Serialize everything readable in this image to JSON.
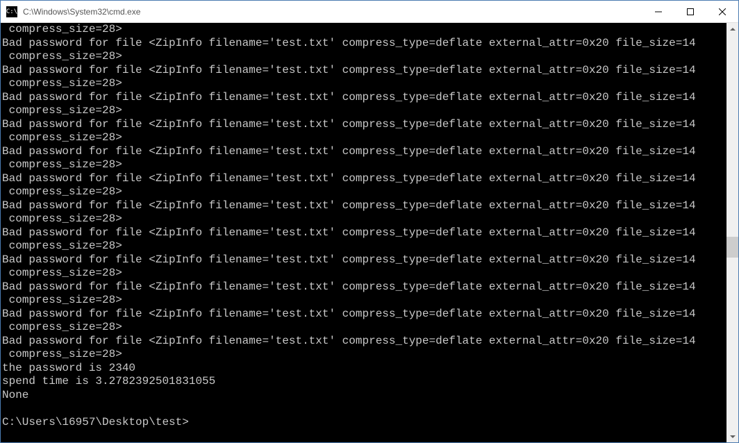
{
  "window": {
    "title": "C:\\Windows\\System32\\cmd.exe",
    "icon_text": "C:\\"
  },
  "terminal": {
    "partial_line": " compress_size=28>",
    "error_line1": "Bad password for file <ZipInfo filename='test.txt' compress_type=deflate external_attr=0x20 file_size=14",
    "error_line2": " compress_size=28>",
    "error_repeat_count": 12,
    "result_password": "the password is 2340",
    "result_time": "spend time is 3.2782392501831055",
    "result_none": "None",
    "blank_line": "",
    "prompt": "C:\\Users\\16957\\Desktop\\test>"
  }
}
